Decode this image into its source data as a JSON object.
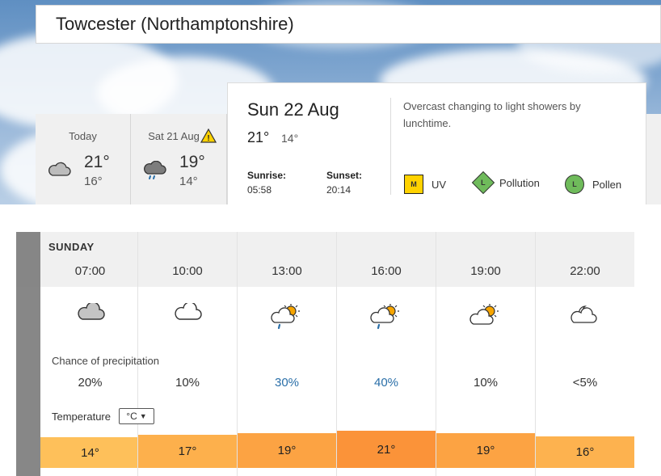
{
  "location": {
    "title": "Towcester (Northamptonshire)"
  },
  "days": [
    {
      "label": "Today",
      "high": "21°",
      "low": "16°",
      "icon": "cloud-icon"
    },
    {
      "label": "Sat 21 Aug",
      "high": "19°",
      "low": "14°",
      "icon": "cloud-rain-icon",
      "warning": "warning-icon"
    }
  ],
  "selected_day": {
    "title": "Sun 22 Aug",
    "high": "21°",
    "low": "14°",
    "sunrise_label": "Sunrise:",
    "sunrise": "05:58",
    "sunset_label": "Sunset:",
    "sunset": "20:14",
    "summary": "Overcast changing to light showers by lunchtime.",
    "uv": {
      "badge": "M",
      "label": "UV"
    },
    "pollution": {
      "badge": "L",
      "label": "Pollution"
    },
    "pollen": {
      "badge": "L",
      "label": "Pollen"
    }
  },
  "hourly": {
    "day_label": "SUNDAY",
    "precip_title": "Chance of precipitation",
    "temp_title": "Temperature",
    "unit": "°C",
    "hours": [
      {
        "time": "07:00",
        "icon": "overcast-cloud-icon",
        "precip": "20%",
        "temp": "14°",
        "color": "#fec05a"
      },
      {
        "time": "10:00",
        "icon": "cloud-icon",
        "precip": "10%",
        "temp": "17°",
        "color": "#fdb04c"
      },
      {
        "time": "13:00",
        "icon": "sun-cloud-rain-icon",
        "precip": "30%",
        "temp": "19°",
        "color": "#fca343"
      },
      {
        "time": "16:00",
        "icon": "sun-cloud-rain-icon",
        "precip": "40%",
        "temp": "21°",
        "color": "#fb9339"
      },
      {
        "time": "19:00",
        "icon": "sun-cloud-icon",
        "precip": "10%",
        "temp": "19°",
        "color": "#fca343"
      },
      {
        "time": "22:00",
        "icon": "moon-cloud-icon",
        "precip": "<5%",
        "temp": "16°",
        "color": "#fdb24f"
      }
    ]
  }
}
